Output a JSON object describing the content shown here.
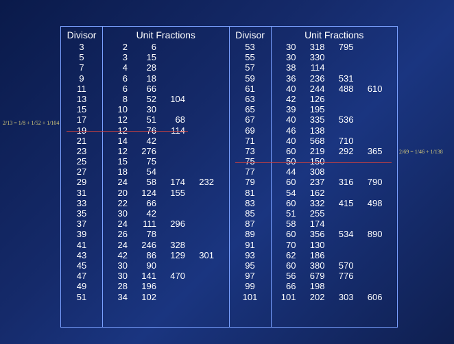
{
  "chart_data": {
    "type": "table",
    "title": "",
    "headers": [
      "Divisor",
      "Unit Fractions"
    ],
    "left": [
      {
        "d": 3,
        "u": [
          2,
          6
        ]
      },
      {
        "d": 5,
        "u": [
          3,
          15
        ]
      },
      {
        "d": 7,
        "u": [
          4,
          28
        ]
      },
      {
        "d": 9,
        "u": [
          6,
          18
        ]
      },
      {
        "d": 11,
        "u": [
          6,
          66
        ]
      },
      {
        "d": 13,
        "u": [
          8,
          52,
          104
        ]
      },
      {
        "d": 15,
        "u": [
          10,
          30
        ]
      },
      {
        "d": 17,
        "u": [
          12,
          51,
          68
        ]
      },
      {
        "d": 19,
        "u": [
          12,
          76,
          114
        ]
      },
      {
        "d": 21,
        "u": [
          14,
          42
        ]
      },
      {
        "d": 23,
        "u": [
          12,
          276
        ]
      },
      {
        "d": 25,
        "u": [
          15,
          75
        ]
      },
      {
        "d": 27,
        "u": [
          18,
          54
        ]
      },
      {
        "d": 29,
        "u": [
          24,
          58,
          174,
          232
        ]
      },
      {
        "d": 31,
        "u": [
          20,
          124,
          155
        ]
      },
      {
        "d": 33,
        "u": [
          22,
          66
        ]
      },
      {
        "d": 35,
        "u": [
          30,
          42
        ]
      },
      {
        "d": 37,
        "u": [
          24,
          111,
          296
        ]
      },
      {
        "d": 39,
        "u": [
          26,
          78
        ]
      },
      {
        "d": 41,
        "u": [
          24,
          246,
          328
        ]
      },
      {
        "d": 43,
        "u": [
          42,
          86,
          129,
          301
        ]
      },
      {
        "d": 45,
        "u": [
          30,
          90
        ]
      },
      {
        "d": 47,
        "u": [
          30,
          141,
          470
        ]
      },
      {
        "d": 49,
        "u": [
          28,
          196
        ]
      },
      {
        "d": 51,
        "u": [
          34,
          102
        ]
      }
    ],
    "right": [
      {
        "d": 53,
        "u": [
          30,
          318,
          795
        ]
      },
      {
        "d": 55,
        "u": [
          30,
          330
        ]
      },
      {
        "d": 57,
        "u": [
          38,
          114
        ]
      },
      {
        "d": 59,
        "u": [
          36,
          236,
          531
        ]
      },
      {
        "d": 61,
        "u": [
          40,
          244,
          488,
          610
        ]
      },
      {
        "d": 63,
        "u": [
          42,
          126
        ]
      },
      {
        "d": 65,
        "u": [
          39,
          195
        ]
      },
      {
        "d": 67,
        "u": [
          40,
          335,
          536
        ]
      },
      {
        "d": 69,
        "u": [
          46,
          138
        ]
      },
      {
        "d": 71,
        "u": [
          40,
          568,
          710
        ]
      },
      {
        "d": 73,
        "u": [
          60,
          219,
          292,
          365
        ]
      },
      {
        "d": 75,
        "u": [
          50,
          150
        ]
      },
      {
        "d": 77,
        "u": [
          44,
          308
        ]
      },
      {
        "d": 79,
        "u": [
          60,
          237,
          316,
          790
        ]
      },
      {
        "d": 81,
        "u": [
          54,
          162
        ]
      },
      {
        "d": 83,
        "u": [
          60,
          332,
          415,
          498
        ]
      },
      {
        "d": 85,
        "u": [
          51,
          255
        ]
      },
      {
        "d": 87,
        "u": [
          58,
          174
        ]
      },
      {
        "d": 89,
        "u": [
          60,
          356,
          534,
          890
        ]
      },
      {
        "d": 91,
        "u": [
          70,
          130
        ]
      },
      {
        "d": 93,
        "u": [
          62,
          186
        ]
      },
      {
        "d": 95,
        "u": [
          60,
          380,
          570
        ]
      },
      {
        "d": 97,
        "u": [
          56,
          679,
          776
        ]
      },
      {
        "d": 99,
        "u": [
          66,
          198
        ]
      },
      {
        "d": 101,
        "u": [
          101,
          202,
          303,
          606
        ]
      }
    ]
  },
  "notes": {
    "left": "2/13 = 1/8 + 1/52 + 1/104",
    "right": "2/69 = 1/46 + 1/138"
  }
}
